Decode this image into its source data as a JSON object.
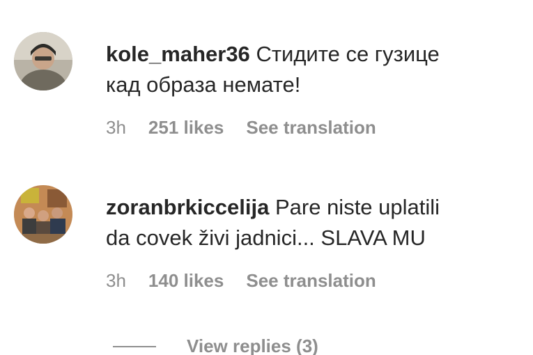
{
  "comments": [
    {
      "username": "kole_maher36",
      "text_line1": "Стидите се гузице",
      "text_line2": "кад образа немате!",
      "time": "3h",
      "likes": "251 likes",
      "translate_label": "See translation"
    },
    {
      "username": "zoranbrkiccelija",
      "text_line1": "Pare niste uplatili",
      "text_line2": "da covek živi jadnici... SLAVA MU",
      "time": "3h",
      "likes": "140 likes",
      "translate_label": "See translation"
    }
  ],
  "view_replies": {
    "label": "View replies (3)"
  },
  "colors": {
    "text": "#262626",
    "secondary": "#8e8e8e"
  }
}
